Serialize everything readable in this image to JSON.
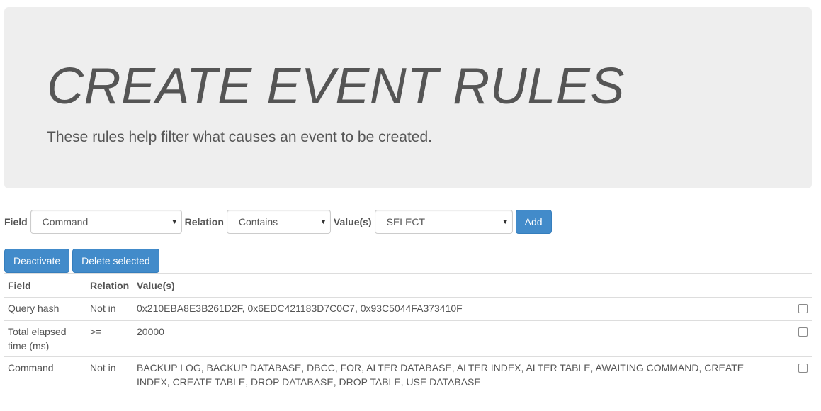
{
  "header": {
    "title": "CREATE EVENT RULES",
    "subtitle": "These rules help filter what causes an event to be created."
  },
  "filter": {
    "field_label": "Field",
    "field_value": "Command",
    "relation_label": "Relation",
    "relation_value": "Contains",
    "values_label": "Value(s)",
    "values_value": "SELECT",
    "add_label": "Add"
  },
  "actions": {
    "deactivate_label": "Deactivate",
    "delete_label": "Delete selected"
  },
  "table": {
    "columns": [
      "Field",
      "Relation",
      "Value(s)"
    ],
    "rows": [
      {
        "field": "Query hash",
        "relation": "Not in",
        "values": "0x210EBA8E3B261D2F, 0x6EDC421183D7C0C7, 0x93C5044FA373410F"
      },
      {
        "field": "Total elapsed time (ms)",
        "relation": ">=",
        "values": "20000"
      },
      {
        "field": "Command",
        "relation": "Not in",
        "values": "BACKUP LOG, BACKUP DATABASE, DBCC, FOR, ALTER DATABASE, ALTER INDEX, ALTER TABLE, AWAITING COMMAND, CREATE INDEX, CREATE TABLE, DROP DATABASE, DROP TABLE, USE DATABASE"
      }
    ]
  },
  "colors": {
    "primary": "#428bca",
    "jumbotron_bg": "#eeeeee",
    "text": "#555555"
  }
}
